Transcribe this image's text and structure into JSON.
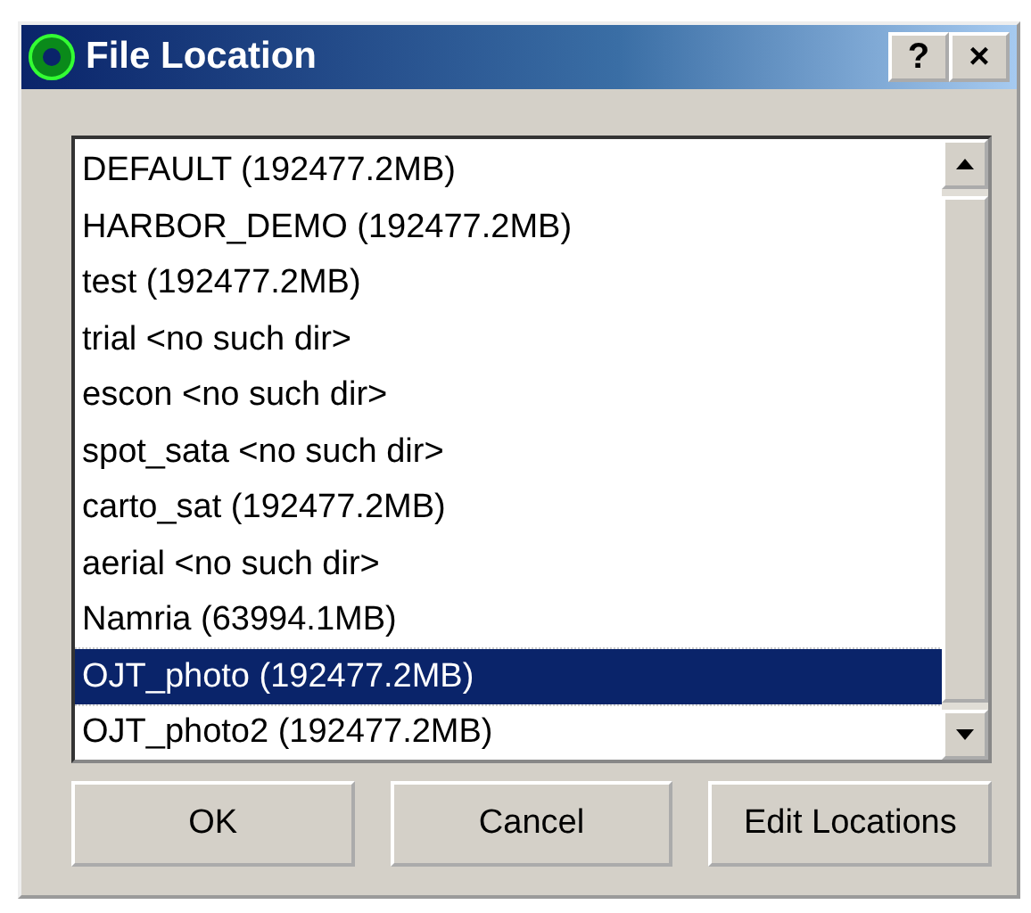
{
  "window": {
    "title": "File Location",
    "title_buttons": [
      "?",
      "×"
    ]
  },
  "list": {
    "items": [
      {
        "label": "DEFAULT (192477.2MB)",
        "selected": false
      },
      {
        "label": "HARBOR_DEMO (192477.2MB)",
        "selected": false
      },
      {
        "label": "test (192477.2MB)",
        "selected": false
      },
      {
        "label": "trial <no such dir>",
        "selected": false
      },
      {
        "label": "escon <no such dir>",
        "selected": false
      },
      {
        "label": "spot_sata <no such dir>",
        "selected": false
      },
      {
        "label": "carto_sat (192477.2MB)",
        "selected": false
      },
      {
        "label": "aerial <no such dir>",
        "selected": false
      },
      {
        "label": "Namria (63994.1MB)",
        "selected": false
      },
      {
        "label": "OJT_photo (192477.2MB)",
        "selected": true
      },
      {
        "label": "OJT_photo2 (192477.2MB)",
        "selected": false
      }
    ]
  },
  "buttons": [
    "OK",
    "Cancel",
    "Edit Locations"
  ]
}
